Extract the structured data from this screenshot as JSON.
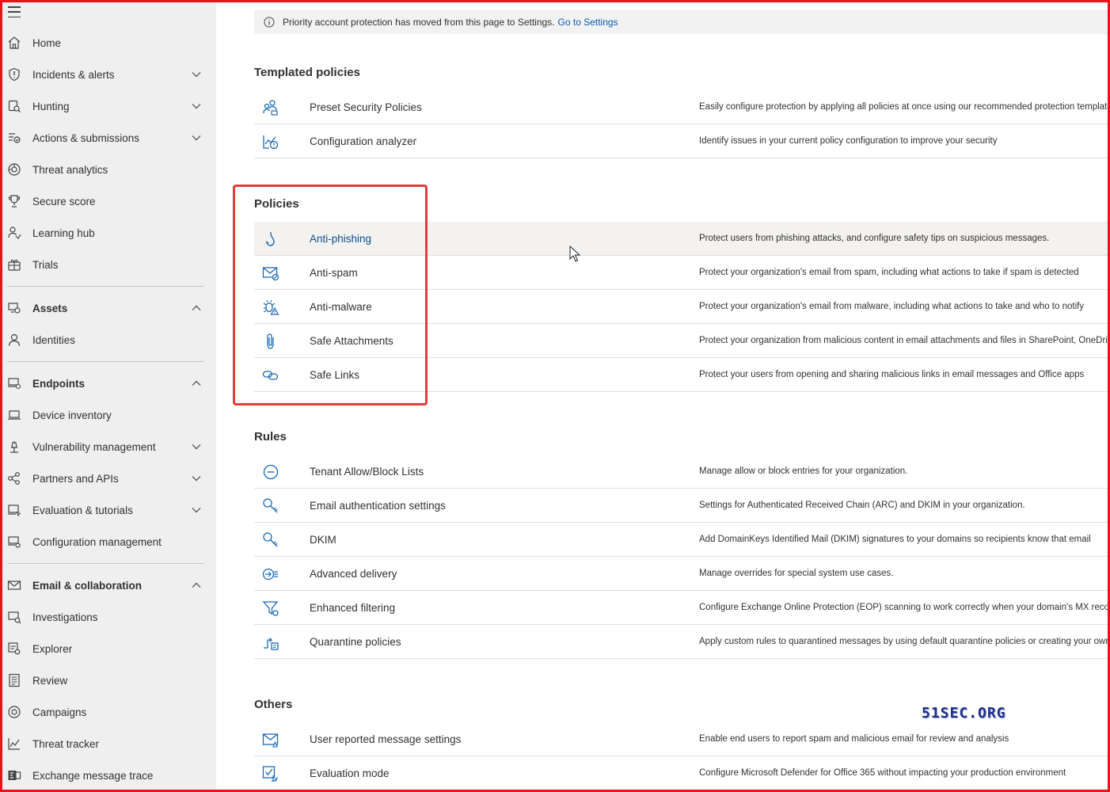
{
  "banner": {
    "text": "Priority account protection has moved from this page to Settings.",
    "link": "Go to Settings"
  },
  "sidebar": {
    "items": [
      {
        "label": "Home",
        "icon": "home-icon"
      },
      {
        "label": "Incidents & alerts",
        "icon": "shield-alert-icon",
        "chevron": "down"
      },
      {
        "label": "Hunting",
        "icon": "hunting-icon",
        "chevron": "down"
      },
      {
        "label": "Actions & submissions",
        "icon": "actions-icon",
        "chevron": "down"
      },
      {
        "label": "Threat analytics",
        "icon": "threat-analytics-icon"
      },
      {
        "label": "Secure score",
        "icon": "trophy-icon"
      },
      {
        "label": "Learning hub",
        "icon": "learning-icon"
      },
      {
        "label": "Trials",
        "icon": "trials-icon"
      }
    ],
    "assets": {
      "label": "Assets",
      "items": [
        {
          "label": "Identities"
        }
      ]
    },
    "endpoints": {
      "label": "Endpoints",
      "items": [
        {
          "label": "Device inventory"
        },
        {
          "label": "Vulnerability management"
        },
        {
          "label": "Partners and APIs"
        },
        {
          "label": "Evaluation & tutorials"
        },
        {
          "label": "Configuration management"
        }
      ]
    },
    "email": {
      "label": "Email & collaboration",
      "items": [
        {
          "label": "Investigations"
        },
        {
          "label": "Explorer"
        },
        {
          "label": "Review"
        },
        {
          "label": "Campaigns"
        },
        {
          "label": "Threat tracker"
        },
        {
          "label": "Exchange message trace"
        }
      ]
    }
  },
  "sections": {
    "templated": {
      "title": "Templated policies",
      "rows": [
        {
          "name": "Preset Security Policies",
          "desc": "Easily configure protection by applying all policies at once using our recommended protection templates"
        },
        {
          "name": "Configuration analyzer",
          "desc": "Identify issues in your current policy configuration to improve your security"
        }
      ]
    },
    "policies": {
      "title": "Policies",
      "rows": [
        {
          "name": "Anti-phishing",
          "desc": "Protect users from phishing attacks, and configure safety tips on suspicious messages."
        },
        {
          "name": "Anti-spam",
          "desc": "Protect your organization's email from spam, including what actions to take if spam is detected"
        },
        {
          "name": "Anti-malware",
          "desc": "Protect your organization's email from malware, including what actions to take and who to notify"
        },
        {
          "name": "Safe Attachments",
          "desc": "Protect your organization from malicious content in email attachments and files in SharePoint, OneDrive"
        },
        {
          "name": "Safe Links",
          "desc": "Protect your users from opening and sharing malicious links in email messages and Office apps"
        }
      ]
    },
    "rules": {
      "title": "Rules",
      "rows": [
        {
          "name": "Tenant Allow/Block Lists",
          "desc": "Manage allow or block entries for your organization."
        },
        {
          "name": "Email authentication settings",
          "desc": "Settings for Authenticated Received Chain (ARC) and DKIM in your organization."
        },
        {
          "name": "DKIM",
          "desc": "Add DomainKeys Identified Mail (DKIM) signatures to your domains so recipients know that email"
        },
        {
          "name": "Advanced delivery",
          "desc": "Manage overrides for special system use cases."
        },
        {
          "name": "Enhanced filtering",
          "desc": "Configure Exchange Online Protection (EOP) scanning to work correctly when your domain's MX record"
        },
        {
          "name": "Quarantine policies",
          "desc": "Apply custom rules to quarantined messages by using default quarantine policies or creating your own"
        }
      ]
    },
    "others": {
      "title": "Others",
      "rows": [
        {
          "name": "User reported message settings",
          "desc": "Enable end users to report spam and malicious email for review and analysis"
        },
        {
          "name": "Evaluation mode",
          "desc": "Configure Microsoft Defender for Office 365 without impacting your production environment"
        }
      ]
    }
  },
  "watermark": "51SEC.ORG",
  "colors": {
    "accent": "#0b5cad",
    "highlight": "#e03c3c",
    "frame": "#e8141b",
    "icon": "#1a6bb8"
  }
}
